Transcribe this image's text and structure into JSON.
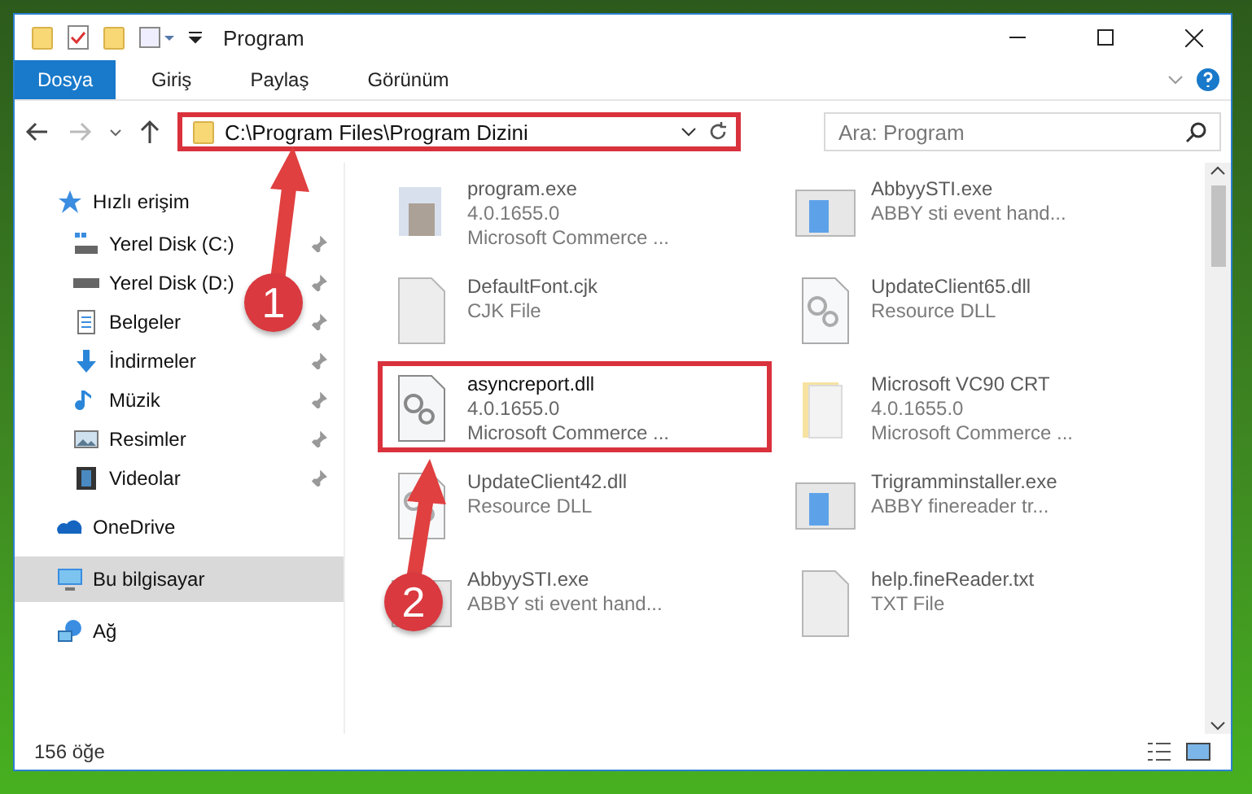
{
  "window": {
    "title": "Program"
  },
  "ribbon_tabs": [
    {
      "label": "Dosya",
      "selected": true
    },
    {
      "label": "Giriş",
      "selected": false
    },
    {
      "label": "Paylaş",
      "selected": false
    },
    {
      "label": "Görünüm",
      "selected": false
    }
  ],
  "address": {
    "path": "C:\\Program Files\\Program Dizini",
    "highlighted": true
  },
  "search": {
    "placeholder": "Ara: Program"
  },
  "sidebar": {
    "items": [
      {
        "label": "Hızlı erişim",
        "kind": "star",
        "selected": false,
        "children": [
          {
            "label": "Yerel Disk (C:)",
            "kind": "windisk",
            "pinned": true
          },
          {
            "label": "Yerel Disk (D:)",
            "kind": "disk",
            "pinned": true
          },
          {
            "label": "Belgeler",
            "kind": "document",
            "pinned": true
          },
          {
            "label": "İndirmeler",
            "kind": "download",
            "pinned": true
          },
          {
            "label": "Müzik",
            "kind": "music",
            "pinned": true
          },
          {
            "label": "Resimler",
            "kind": "picture",
            "pinned": true
          },
          {
            "label": "Videolar",
            "kind": "video",
            "pinned": true
          }
        ]
      },
      {
        "label": "OneDrive",
        "kind": "cloud",
        "selected": false
      },
      {
        "label": "Bu bilgisayar",
        "kind": "computer",
        "selected": true
      },
      {
        "label": "Ağ",
        "kind": "network",
        "selected": false
      }
    ]
  },
  "files": [
    {
      "name": "program.exe",
      "details": [
        "4.0.1655.0",
        "Microsoft Commerce ..."
      ],
      "kind": "app",
      "blurred": true,
      "highlighted": false
    },
    {
      "name": "AbbyySTI.exe",
      "details": [
        "ABBY sti event hand..."
      ],
      "kind": "window",
      "blurred": true,
      "highlighted": false
    },
    {
      "name": "DefaultFont.cjk",
      "details": [
        "CJK File"
      ],
      "kind": "blank",
      "blurred": true,
      "highlighted": false
    },
    {
      "name": "UpdateClient65.dll",
      "details": [
        "Resource DLL"
      ],
      "kind": "gear",
      "blurred": true,
      "highlighted": false
    },
    {
      "name": "asyncreport.dll",
      "details": [
        "4.0.1655.0",
        "Microsoft Commerce ..."
      ],
      "kind": "gear",
      "blurred": false,
      "highlighted": true
    },
    {
      "name": "Microsoft VC90 CRT",
      "details": [
        "4.0.1655.0",
        "Microsoft Commerce ..."
      ],
      "kind": "folder",
      "blurred": true,
      "highlighted": false
    },
    {
      "name": "UpdateClient42.dll",
      "details": [
        "Resource DLL"
      ],
      "kind": "gear",
      "blurred": true,
      "highlighted": false
    },
    {
      "name": "Trigramminstaller.exe",
      "details": [
        "ABBY finereader tr..."
      ],
      "kind": "window",
      "blurred": true,
      "highlighted": false
    },
    {
      "name": "AbbyySTI.exe",
      "details": [
        "ABBY sti event hand..."
      ],
      "kind": "window",
      "blurred": true,
      "highlighted": false
    },
    {
      "name": "help.fineReader.txt",
      "details": [
        "TXT File"
      ],
      "kind": "blank",
      "blurred": true,
      "highlighted": false
    }
  ],
  "status_bar": {
    "count": "156 öğe"
  },
  "annotations": [
    {
      "number": "1"
    },
    {
      "number": "2"
    }
  ]
}
